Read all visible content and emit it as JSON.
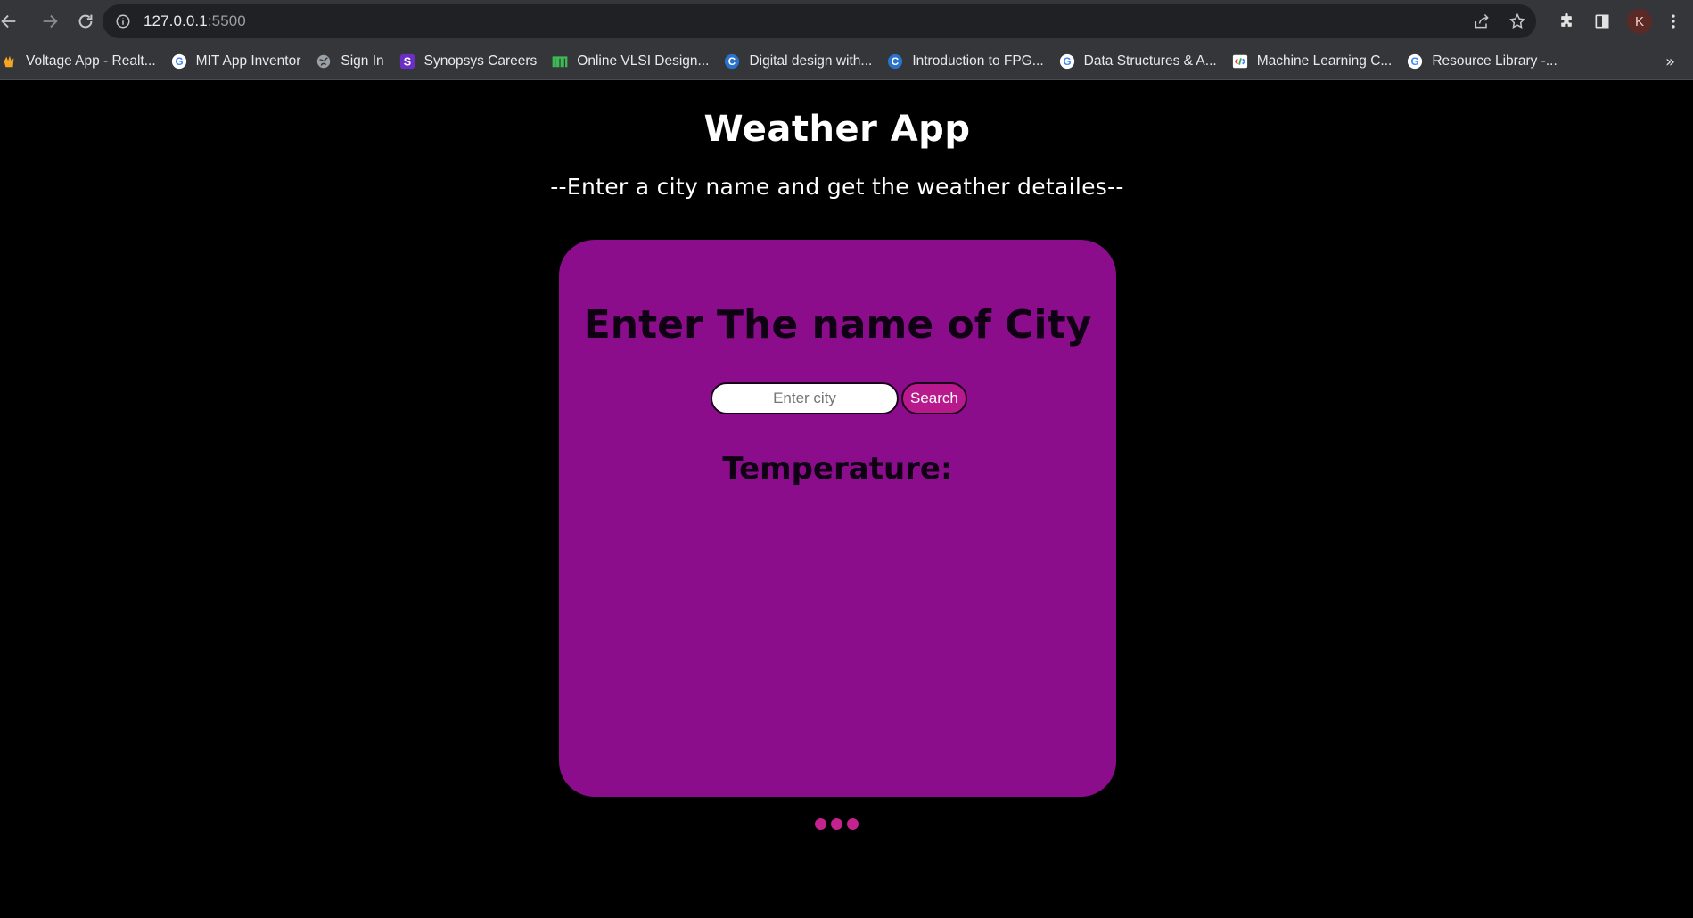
{
  "browser": {
    "url_host": "127.0.0.1",
    "url_port": ":5500",
    "profile_initial": "K",
    "bookmarks": [
      {
        "label": "Voltage App - Realt...",
        "icon": "hand-favicon"
      },
      {
        "label": "MIT App Inventor",
        "icon": "google-favicon"
      },
      {
        "label": "Sign In",
        "icon": "globe-favicon"
      },
      {
        "label": "Synopsys Careers",
        "icon": "synopsys-favicon"
      },
      {
        "label": "Online VLSI Design...",
        "icon": "m-favicon"
      },
      {
        "label": "Digital design with...",
        "icon": "coursera-favicon"
      },
      {
        "label": "Introduction to FPG...",
        "icon": "coursera-favicon"
      },
      {
        "label": "Data Structures & A...",
        "icon": "google-favicon"
      },
      {
        "label": "Machine Learning C...",
        "icon": "google-dev-favicon"
      },
      {
        "label": "Resource Library -...",
        "icon": "google-favicon"
      }
    ]
  },
  "app": {
    "title": "Weather App",
    "subtitle": "--Enter a city name and get the weather detailes--",
    "card_title": "Enter The name of City",
    "search_placeholder": "Enter city",
    "search_button": "Search",
    "temperature_label": "Temperature:"
  },
  "colors": {
    "card_bg": "#8b0d8b",
    "button_bg": "#b81a8e",
    "loader_dot": "#c2238f",
    "page_bg": "#000000"
  }
}
